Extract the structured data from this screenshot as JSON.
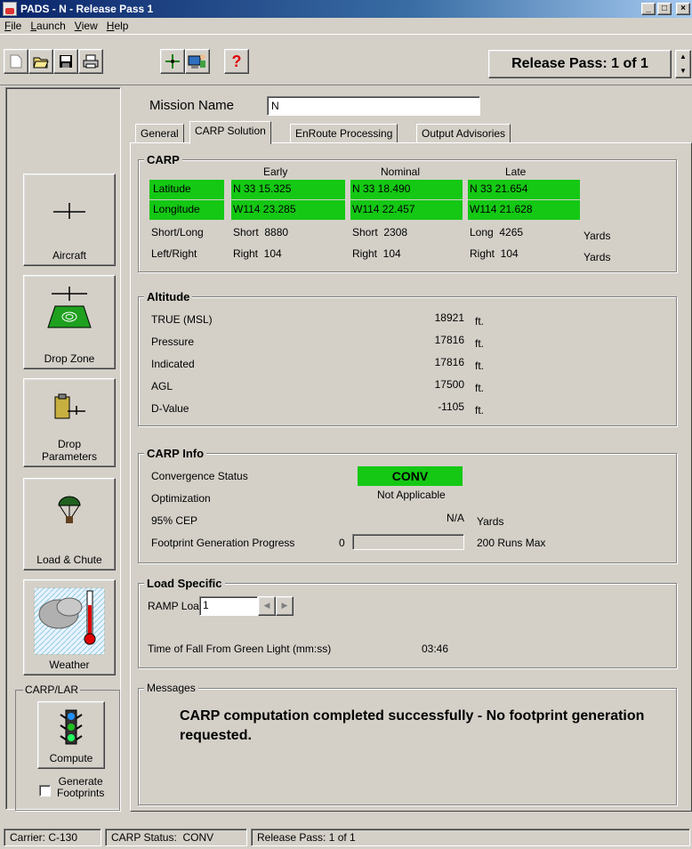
{
  "window": {
    "title": "PADS - N - Release Pass 1"
  },
  "menu": [
    "File",
    "Launch",
    "View",
    "Help"
  ],
  "menu_underline": [
    "F",
    "L",
    "V",
    "H"
  ],
  "toolbar": {
    "icons": [
      "new-document-icon",
      "open-folder-icon",
      "save-disk-icon",
      "print-icon",
      "move-crosshair-icon",
      "computer-user-icon",
      "help-question-icon"
    ],
    "help_glyph": "?",
    "release_pass": "Release Pass: 1 of 1"
  },
  "nav": {
    "aircraft": "Aircraft",
    "drop_zone": "Drop Zone",
    "drop_parameters": "Drop\nParameters",
    "load_chute": "Load & Chute",
    "weather": "Weather",
    "group_label": "CARP/LAR",
    "compute": "Compute",
    "generate_footprints": "Generate\nFootprints"
  },
  "mission": {
    "label": "Mission Name",
    "value": "N"
  },
  "tabs": [
    "General",
    "CARP Solution",
    "EnRoute Processing",
    "Output Advisories"
  ],
  "carp": {
    "title": "CARP",
    "columns": [
      "Early",
      "Nominal",
      "Late"
    ],
    "rows": [
      {
        "label": "Latitude",
        "values": [
          "N 33 15.325",
          "N 33 18.490",
          "N 33 21.654"
        ],
        "unit": ""
      },
      {
        "label": "Longitude",
        "values": [
          "W114 23.285",
          "W114 22.457",
          "W114 21.628"
        ],
        "unit": ""
      },
      {
        "label": "Short/Long",
        "values": [
          "Short  8880",
          "Short  2308",
          "Long  4265"
        ],
        "unit": "Yards"
      },
      {
        "label": "Left/Right",
        "values": [
          "Right  104",
          "Right  104",
          "Right  104"
        ],
        "unit": "Yards"
      }
    ]
  },
  "altitude": {
    "title": "Altitude",
    "rows": [
      {
        "label": "TRUE (MSL)",
        "value": "18921",
        "unit": "ft."
      },
      {
        "label": "Pressure",
        "value": "17816",
        "unit": "ft."
      },
      {
        "label": "Indicated",
        "value": "17816",
        "unit": "ft."
      },
      {
        "label": "AGL",
        "value": "17500",
        "unit": "ft."
      },
      {
        "label": "D-Value",
        "value": "-1105",
        "unit": "ft."
      }
    ]
  },
  "carp_info": {
    "title": "CARP Info",
    "convergence_label": "Convergence Status",
    "convergence_value": "CONV",
    "optimization_label": "Optimization",
    "optimization_value": "Not Applicable",
    "cep_label": "95% CEP",
    "cep_value": "N/A",
    "cep_unit": "Yards",
    "progress_label": "Footprint Generation Progress",
    "progress_start": "0",
    "progress_fraction": 0,
    "progress_max": "200 Runs Max"
  },
  "load_specific": {
    "title": "Load Specific",
    "ramp_label": "RAMP Load",
    "ramp_value": "1",
    "tof_label": "Time of Fall From Green Light (mm:ss)",
    "tof_value": "03:46"
  },
  "messages": {
    "title": "Messages",
    "text": "CARP computation completed successfully - No footprint generation requested."
  },
  "status": {
    "carrier": "Carrier: C-130",
    "carp_status": "CARP Status:  CONV",
    "release_pass": "Release Pass: 1 of 1"
  },
  "colors": {
    "highlight_green": "#14c814",
    "title_bar": "#0a246a",
    "face": "#d4d0c8"
  }
}
